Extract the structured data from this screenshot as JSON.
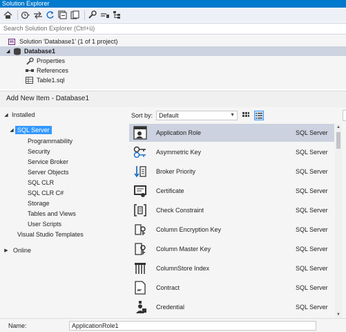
{
  "solution_explorer": {
    "title": "Solution Explorer",
    "toolbar": {
      "icons": [
        "home-icon",
        "history-icon",
        "sync-icon",
        "refresh-icon",
        "collapse-all-icon",
        "show-all-files-icon",
        "properties-wrench-icon",
        "preview-icon",
        "class-view-icon"
      ]
    },
    "search_placeholder": "Search Solution Explorer (Ctrl+ü)",
    "tree": {
      "solution": "Solution 'Database1' (1 of 1 project)",
      "project": "Database1",
      "children": [
        "Properties",
        "References",
        "Table1.sql"
      ]
    }
  },
  "dialog": {
    "title": "Add New Item - Database1",
    "left_tree": {
      "installed": "Installed",
      "sql_server": "SQL Server",
      "sql_children": [
        "Programmability",
        "Security",
        "Service Broker",
        "Server Objects",
        "SQL CLR",
        "SQL CLR C#",
        "Storage",
        "Tables and Views",
        "User Scripts"
      ],
      "vs_templates": "Visual Studio Templates",
      "online": "Online"
    },
    "sort": {
      "label": "Sort by:",
      "value": "Default"
    },
    "items": [
      {
        "name": "Application Role",
        "category": "SQL Server",
        "icon": "application-role-icon"
      },
      {
        "name": "Asymmetric Key",
        "category": "SQL Server",
        "icon": "asymmetric-key-icon"
      },
      {
        "name": "Broker Priority",
        "category": "SQL Server",
        "icon": "broker-priority-icon"
      },
      {
        "name": "Certificate",
        "category": "SQL Server",
        "icon": "certificate-icon"
      },
      {
        "name": "Check Constraint",
        "category": "SQL Server",
        "icon": "check-constraint-icon"
      },
      {
        "name": "Column Encryption Key",
        "category": "SQL Server",
        "icon": "column-encryption-key-icon"
      },
      {
        "name": "Column Master Key",
        "category": "SQL Server",
        "icon": "column-master-key-icon"
      },
      {
        "name": "ColumnStore Index",
        "category": "SQL Server",
        "icon": "columnstore-index-icon"
      },
      {
        "name": "Contract",
        "category": "SQL Server",
        "icon": "contract-icon"
      },
      {
        "name": "Credential",
        "category": "SQL Server",
        "icon": "credential-icon"
      }
    ],
    "name_label": "Name:",
    "name_value": "ApplicationRole1"
  },
  "colors": {
    "accent": "#007acc",
    "selection": "#3399ff",
    "row_selected": "#ccd2df"
  }
}
